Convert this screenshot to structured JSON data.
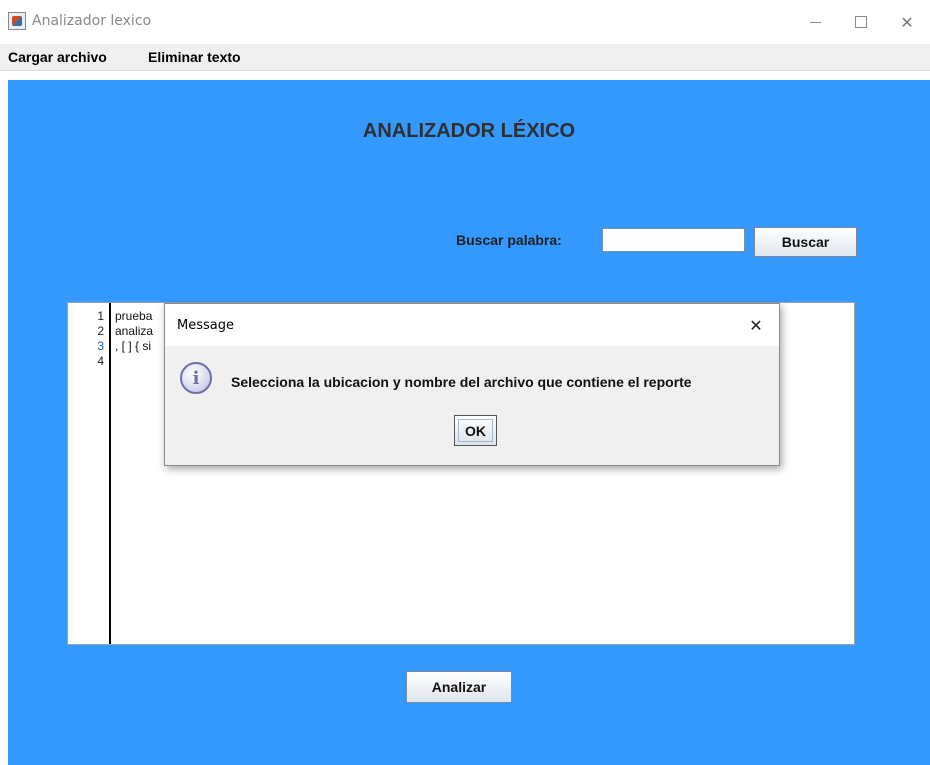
{
  "window": {
    "title": "Analizador lexico",
    "controls": {
      "minimize": "—",
      "maximize": "□",
      "close": "✕"
    }
  },
  "menu": [
    "Cargar archivo",
    "Eliminar texto"
  ],
  "main": {
    "heading": "ANALIZADOR LÉXICO",
    "search_label": "Buscar palabra:",
    "search_value": "",
    "search_button": "Buscar",
    "analyze_button": "Analizar"
  },
  "editor": {
    "line_numbers": [
      "1",
      "2",
      "3",
      "4"
    ],
    "lines": [
      "prueba",
      "analiza",
      ", [ ] { si",
      ""
    ],
    "current_line": 3
  },
  "dialog": {
    "title": "Message",
    "close": "✕",
    "icon": "info-icon",
    "icon_glyph": "i",
    "message": "Selecciona la ubicacion y nombre del archivo que contiene el reporte",
    "ok_label": "OK"
  },
  "colors": {
    "content_bg": "#3399ff",
    "heading_text": "#2f2f2f"
  }
}
